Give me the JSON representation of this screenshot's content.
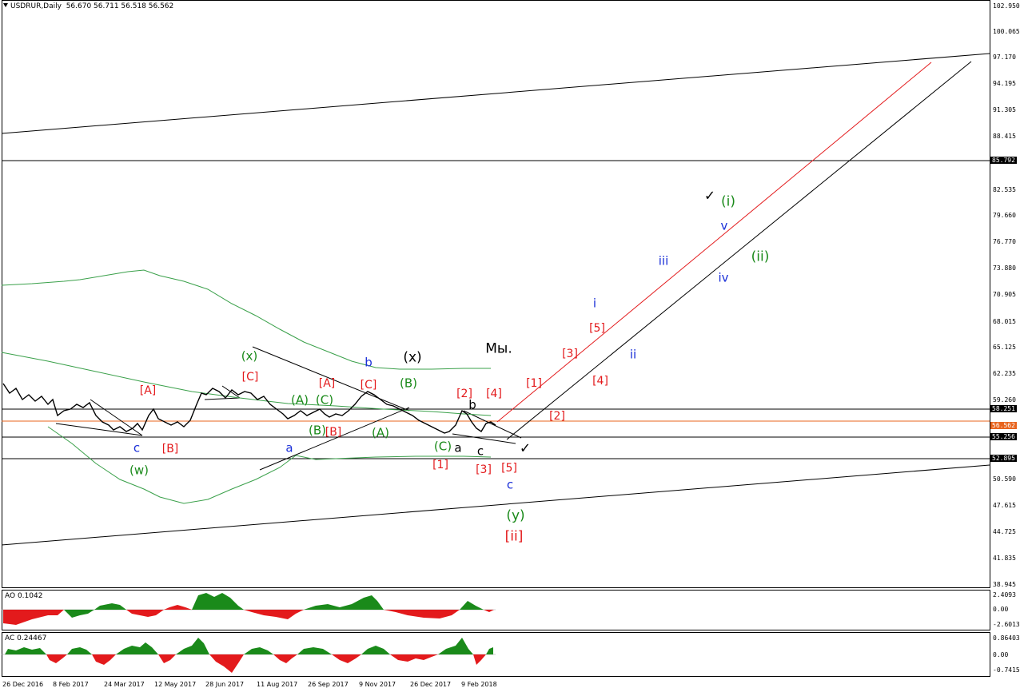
{
  "header": {
    "symbol": "USDRUR,Daily",
    "ohlc": "56.670 56.711 56.518 56.562"
  },
  "ao": {
    "title": "AO 0.1042",
    "ticks": [
      "2.4093",
      "0.00",
      "-2.6013"
    ]
  },
  "ac": {
    "title": "AC 0.24467",
    "ticks": [
      "0.86403",
      "0.00",
      "-0.74154"
    ]
  },
  "price_ticks": [
    "102.950",
    "100.065",
    "97.170",
    "94.195",
    "91.305",
    "88.415",
    "85.792",
    "82.535",
    "79.660",
    "76.770",
    "73.880",
    "70.905",
    "68.015",
    "65.125",
    "62.235",
    "59.260",
    "58.251",
    "56.562",
    "55.256",
    "52.895",
    "50.590",
    "47.615",
    "44.725",
    "41.835",
    "38.945"
  ],
  "x_labels": [
    "26 Dec 2016",
    "8 Feb 2017",
    "24 Mar 2017",
    "12 May 2017",
    "28 Jun 2017",
    "11 Aug 2017",
    "26 Sep 2017",
    "9 Nov 2017",
    "26 Dec 2017",
    "9 Feb 2018"
  ],
  "wave_labels": {
    "red": [
      "[A]",
      "[B]",
      "[C]",
      "[A]",
      "[B]",
      "[C]",
      "[1]",
      "[2]",
      "[3]",
      "[4]",
      "[5]",
      "[1]",
      "[2]",
      "[3]",
      "[4]",
      "[5]",
      "[ii]"
    ],
    "green": [
      "(w)",
      "(x)",
      "(A)",
      "(B)",
      "(C)",
      "(A)",
      "(B)",
      "(C)",
      "(y)",
      "(i)",
      "(ii)"
    ],
    "blue": [
      "c",
      "a",
      "b",
      "c",
      "i",
      "ii",
      "iii",
      "iv",
      "v"
    ],
    "black": [
      "(x)",
      "a",
      "b",
      "c",
      "Мы."
    ]
  },
  "checkmarks": [
    "✓",
    "✓"
  ],
  "colors": {
    "red": "#e31a1c",
    "green": "#1a8a1a",
    "blue": "#1b30d8",
    "orange": "#e8641e"
  }
}
